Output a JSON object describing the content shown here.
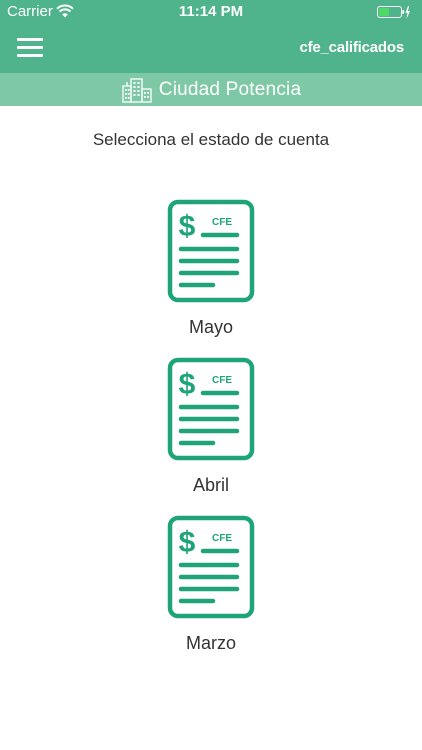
{
  "status_bar": {
    "carrier": "Carrier",
    "time": "11:14 PM"
  },
  "navbar": {
    "username": "cfe_calificados",
    "menu_icon": "hamburger-menu-icon"
  },
  "brand": {
    "name": "Ciudad Potencia",
    "icon": "city-buildings-icon"
  },
  "prompt": "Selecciona el estado de cuenta",
  "statements": [
    {
      "month": "Mayo",
      "icon_label": "CFE",
      "icon_symbol": "$"
    },
    {
      "month": "Abril",
      "icon_label": "CFE",
      "icon_symbol": "$"
    },
    {
      "month": "Marzo",
      "icon_label": "CFE",
      "icon_symbol": "$"
    }
  ],
  "colors": {
    "primary": "#4fb38c",
    "secondary": "#7fc8a6",
    "icon": "#1fa47a",
    "battery_fill": "#4cd964"
  }
}
